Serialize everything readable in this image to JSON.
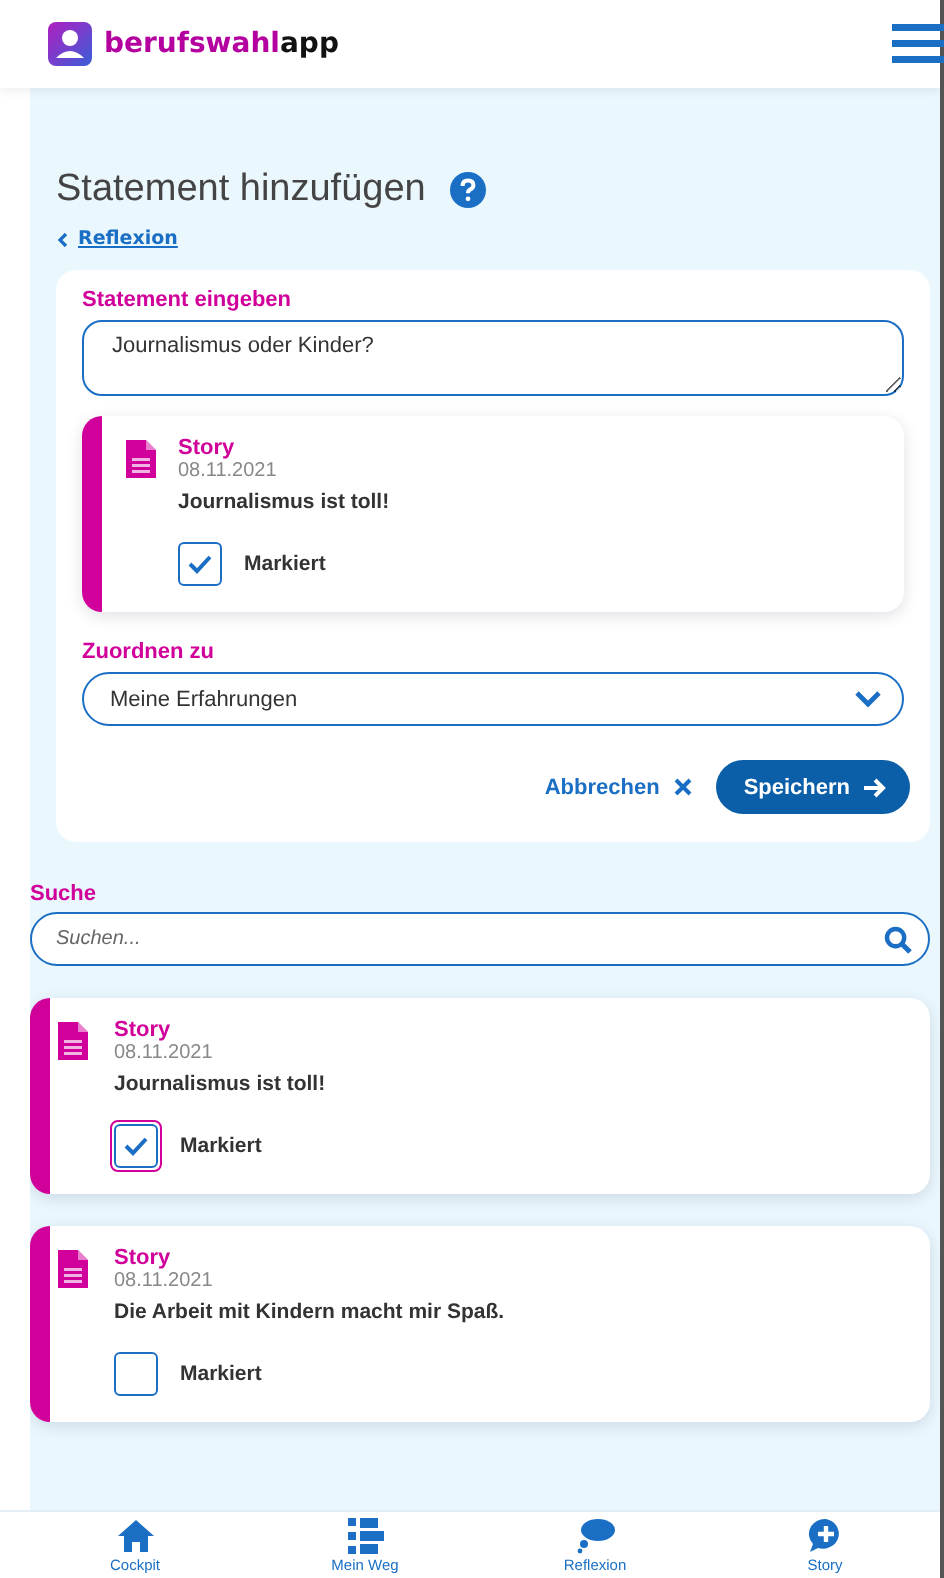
{
  "header": {
    "brand_part1": "berufswahl",
    "brand_part2": "app"
  },
  "page": {
    "title": "Statement hinzufügen",
    "back_link": "Reflexion"
  },
  "form": {
    "statement_label": "Statement eingeben",
    "statement_value": "Journalismus oder Kinder?",
    "selected_story": {
      "type": "Story",
      "date": "08.11.2021",
      "text": "Journalismus ist toll!",
      "checkbox_label": "Markiert",
      "checked": true,
      "focused": false
    },
    "assign_label": "Zuordnen zu",
    "assign_value": "Meine Erfahrungen",
    "cancel": "Abbrechen",
    "save": "Speichern"
  },
  "search": {
    "label": "Suche",
    "placeholder": "Suchen..."
  },
  "stories": [
    {
      "type": "Story",
      "date": "08.11.2021",
      "text": "Journalismus ist toll!",
      "checkbox_label": "Markiert",
      "checked": true,
      "focused": true
    },
    {
      "type": "Story",
      "date": "08.11.2021",
      "text": "Die Arbeit mit Kindern macht mir Spaß.",
      "checkbox_label": "Markiert",
      "checked": false,
      "focused": false
    }
  ],
  "bottom_nav": [
    {
      "label": "Cockpit",
      "kind": "home"
    },
    {
      "label": "Mein Weg",
      "kind": "path"
    },
    {
      "label": "Reflexion",
      "kind": "thought"
    },
    {
      "label": "Story",
      "kind": "add"
    }
  ]
}
